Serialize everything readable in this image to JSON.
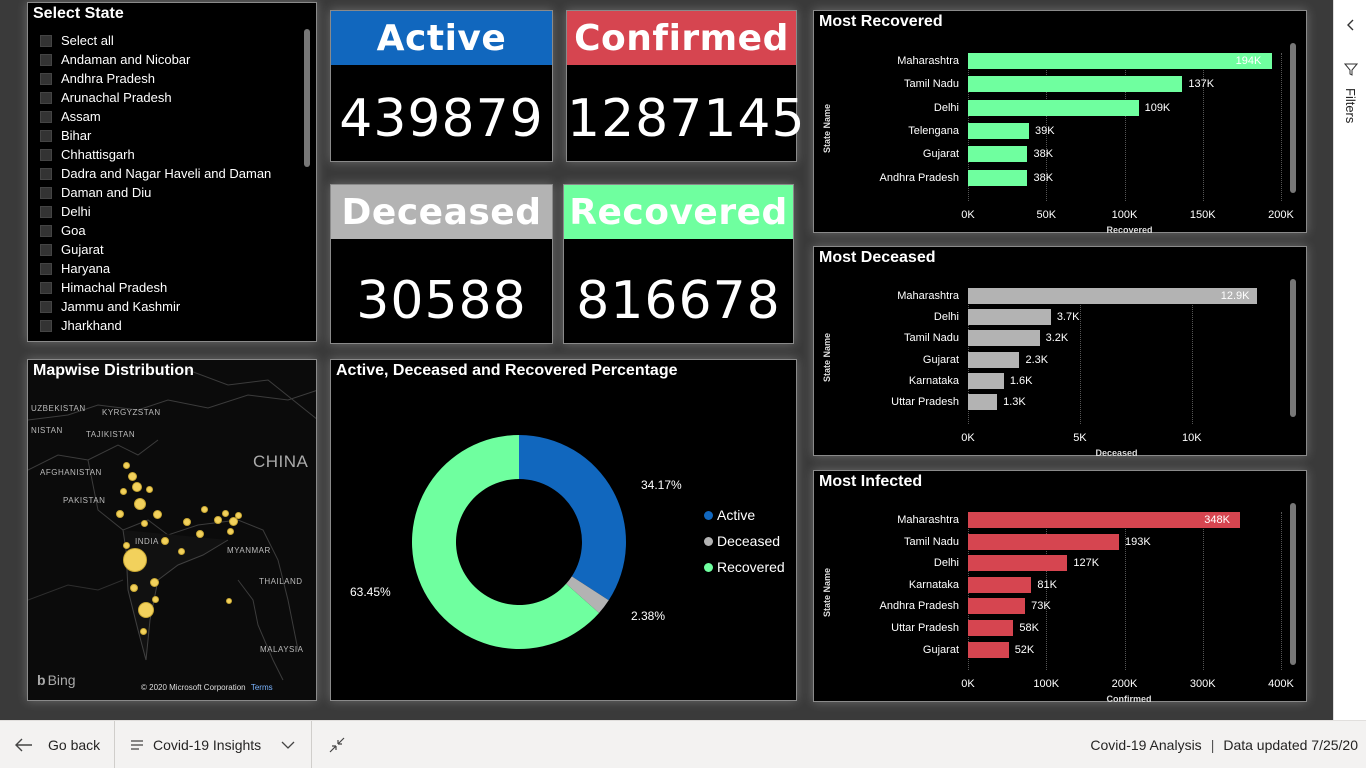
{
  "slicer": {
    "title": "Select State",
    "items": [
      "Select all",
      "Andaman and Nicobar",
      "Andhra Pradesh",
      "Arunachal Pradesh",
      "Assam",
      "Bihar",
      "Chhattisgarh",
      "Dadra and Nagar Haveli and Daman",
      "Daman and Diu",
      "Delhi",
      "Goa",
      "Gujarat",
      "Haryana",
      "Himachal Pradesh",
      "Jammu and Kashmir",
      "Jharkhand"
    ]
  },
  "kpis": {
    "active": {
      "label": "Active",
      "value": "439879",
      "color": "#1167be"
    },
    "confirmed": {
      "label": "Confirmed",
      "value": "1287145",
      "color": "#d64550"
    },
    "deceased": {
      "label": "Deceased",
      "value": "30588",
      "color": "#b3b3b3"
    },
    "recovered": {
      "label": "Recovered",
      "value": "816678",
      "color": "#6fff9f"
    }
  },
  "map": {
    "title": "Mapwise Distribution",
    "labels": {
      "uzbekistan": "UZBEKISTAN",
      "kyrgyzstan": "KYRGYZSTAN",
      "tajikistan": "TAJIKISTAN",
      "turkmenistan": "NISTAN",
      "afghanistan": "AFGHANISTAN",
      "pakistan": "PAKISTAN",
      "china": "CHINA",
      "india": "INDIA",
      "myanmar": "MYANMAR",
      "thailand": "THAILAND",
      "malaysia": "MALAYSIA"
    },
    "copyright": "© 2020 Microsoft Corporation",
    "terms": "Terms",
    "bing": "Bing"
  },
  "donut": {
    "title": "Active, Deceased and Recovered Percentage",
    "labels": {
      "active": "34.17%",
      "deceased": "2.38%",
      "recovered": "63.45%"
    }
  },
  "chart_data": [
    {
      "type": "pie",
      "title": "Active, Deceased and Recovered Percentage",
      "categories": [
        "Active",
        "Deceased",
        "Recovered"
      ],
      "values": [
        34.17,
        2.38,
        63.45
      ],
      "colors": [
        "#1167be",
        "#b3b3b3",
        "#6fff9f"
      ],
      "legend": "right"
    },
    {
      "type": "bar",
      "title": "Most Recovered",
      "categories": [
        "Maharashtra",
        "Tamil Nadu",
        "Delhi",
        "Telengana",
        "Gujarat",
        "Andhra Pradesh"
      ],
      "values": [
        194000,
        137000,
        109000,
        39000,
        38000,
        38000
      ],
      "data_labels": [
        "194K",
        "137K",
        "109K",
        "39K",
        "38K",
        "38K"
      ],
      "xlabel": "Recovered",
      "ylabel": "State Name",
      "xlim": [
        0,
        200000
      ],
      "ticks": [
        "0K",
        "50K",
        "100K",
        "150K",
        "200K"
      ],
      "color": "#6fff9f"
    },
    {
      "type": "bar",
      "title": "Most Deceased",
      "categories": [
        "Maharashtra",
        "Delhi",
        "Tamil Nadu",
        "Gujarat",
        "Karnataka",
        "Uttar Pradesh"
      ],
      "values": [
        12900,
        3700,
        3200,
        2300,
        1600,
        1300
      ],
      "data_labels": [
        "12.9K",
        "3.7K",
        "3.2K",
        "2.3K",
        "1.6K",
        "1.3K"
      ],
      "xlabel": "Deceased",
      "ylabel": "State Name",
      "xlim": [
        0,
        13000
      ],
      "ticks": [
        "0K",
        "5K",
        "10K"
      ],
      "tick_values": [
        0,
        5000,
        10000
      ],
      "color": "#b3b3b3"
    },
    {
      "type": "bar",
      "title": "Most Infected",
      "categories": [
        "Maharashtra",
        "Tamil Nadu",
        "Delhi",
        "Karnataka",
        "Andhra Pradesh",
        "Uttar Pradesh",
        "Gujarat"
      ],
      "values": [
        348000,
        193000,
        127000,
        81000,
        73000,
        58000,
        52000
      ],
      "data_labels": [
        "348K",
        "193K",
        "127K",
        "81K",
        "73K",
        "58K",
        "52K"
      ],
      "xlabel": "Confirmed",
      "ylabel": "State Name",
      "xlim": [
        0,
        400000
      ],
      "ticks": [
        "0K",
        "100K",
        "200K",
        "300K",
        "400K"
      ],
      "color": "#d64550"
    }
  ],
  "filters": {
    "label": "Filters"
  },
  "bottom": {
    "go_back": "Go back",
    "page_name": "Covid-19 Insights",
    "report_name": "Covid-19 Analysis",
    "data_updated": "Data updated 7/25/20"
  }
}
